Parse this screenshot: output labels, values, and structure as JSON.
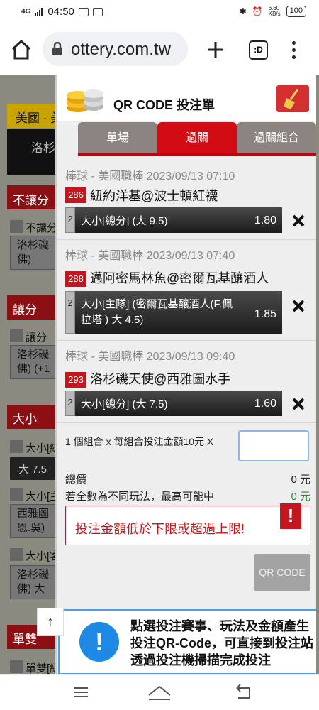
{
  "status": {
    "signal": "4G",
    "time": "04:50",
    "speed": "6.60\nKB/s",
    "battery": "100"
  },
  "browser": {
    "url": "ottery.com.tw",
    "tabs_label": ":D"
  },
  "background": {
    "header": "美國 - 美",
    "team1": "洛杉",
    "sections": [
      {
        "title": "不讓分",
        "row": "不讓分",
        "box": "洛杉磯\n佛)"
      },
      {
        "title": "讓分",
        "row": "讓分",
        "box": "洛杉磯\n佛) (+1"
      },
      {
        "title": "大小",
        "row": "大小[總",
        "box_dark": "大 7.5"
      },
      {
        "row": "大小[主",
        "box": "西雅圖\n恩.吳)"
      },
      {
        "row": "大小[客",
        "box": "洛杉磯\n佛) 大"
      },
      {
        "title": "單雙",
        "row": "單雙[總"
      }
    ]
  },
  "panel": {
    "title": "QR CODE 投注單",
    "tabs": [
      "單場",
      "過關",
      "過關組合"
    ],
    "active_tab": "過關",
    "bets": [
      {
        "date": "棒球 - 美國職棒 2023/09/13 07:10",
        "num": "286",
        "teams": "紐約洋基@波士頓紅襪",
        "sel_idx": "2",
        "selection": "大小[總分] (大 9.5)",
        "odds": "1.80"
      },
      {
        "date": "棒球 - 美國職棒 2023/09/13 07:40",
        "num": "288",
        "teams": "邁阿密馬林魚@密爾瓦基釀酒人",
        "sel_idx": "2",
        "selection": "大小[主隊] (密爾瓦基釀酒人(F.佩拉塔 ) 大 4.5)",
        "odds": "1.85"
      },
      {
        "date": "棒球 - 美國職棒 2023/09/13 09:40",
        "num": "293",
        "teams": "洛杉磯天使@西雅圖水手",
        "sel_idx": "2",
        "selection": "大小[總分] (大 7.5)",
        "odds": "1.60"
      }
    ],
    "combo_text": "1 個組合 x 每組合投注金額10元 X",
    "amount_value": "",
    "total_label": "總價",
    "total_value": "0 元",
    "max_label": "若全數為不同玩法，最高可能中",
    "max_value": "0 元",
    "error": "投注金額低於下限或超過上限!",
    "error_icon": "!",
    "qr_button": "QR CODE",
    "help_icon": "!",
    "help_text": "點選投注賽事、玩法及金額產生投注QR-Code，可直接到投注站透過投注機掃描完成投注"
  },
  "scroll_top": "↑",
  "colors": {
    "accent": "#c4161c",
    "tab_active": "#d10c15",
    "tab": "#8b8481",
    "help_border": "#4c9ee8"
  }
}
